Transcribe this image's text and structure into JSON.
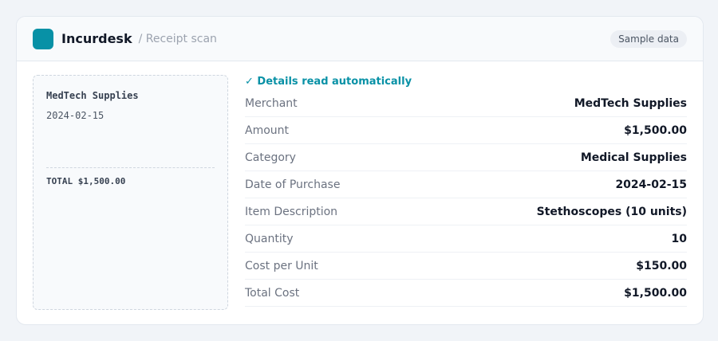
{
  "app": {
    "name": "Incurdesk",
    "breadcrumb": "/ Receipt scan",
    "badge": "Sample data",
    "accent_color": "#0891a6"
  },
  "receipt": {
    "merchant": "MedTech Supplies",
    "date": "2024-02-15",
    "total": "TOTAL $1,500.00"
  },
  "details": {
    "status": "✓ Details read automatically",
    "fields": [
      {
        "label": "Merchant",
        "value": "MedTech Supplies"
      },
      {
        "label": "Amount",
        "value": "$1,500.00"
      },
      {
        "label": "Category",
        "value": "Medical Supplies"
      },
      {
        "label": "Date of Purchase",
        "value": "2024-02-15"
      },
      {
        "label": "Item Description",
        "value": "Stethoscopes (10 units)"
      },
      {
        "label": "Quantity",
        "value": "10"
      },
      {
        "label": "Cost per Unit",
        "value": "$150.00"
      },
      {
        "label": "Total Cost",
        "value": "$1,500.00"
      }
    ]
  }
}
